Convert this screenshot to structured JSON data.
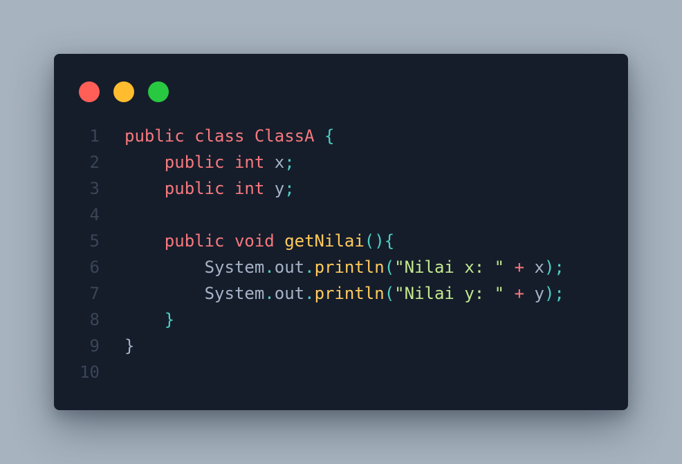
{
  "window": {
    "controls": [
      {
        "name": "close",
        "color": "#ff5f57"
      },
      {
        "name": "minimize",
        "color": "#febc2e"
      },
      {
        "name": "maximize",
        "color": "#28c840"
      }
    ]
  },
  "colors": {
    "keyword": "#f7797d",
    "function": "#ffcb5c",
    "string": "#c3e88d",
    "punctuation": "#4fd1c5",
    "identifier": "#a6b3c6",
    "line_number": "#3a4556",
    "background": "#151d2b"
  },
  "code": {
    "language": "java",
    "lines": [
      {
        "n": "1",
        "tokens": [
          {
            "t": "public",
            "c": "kw"
          },
          {
            "t": " ",
            "c": "id"
          },
          {
            "t": "class",
            "c": "kw"
          },
          {
            "t": " ",
            "c": "id"
          },
          {
            "t": "ClassA",
            "c": "kw"
          },
          {
            "t": " ",
            "c": "id"
          },
          {
            "t": "{",
            "c": "pn"
          }
        ]
      },
      {
        "n": "2",
        "tokens": [
          {
            "t": "    ",
            "c": "id"
          },
          {
            "t": "public",
            "c": "kw"
          },
          {
            "t": " ",
            "c": "id"
          },
          {
            "t": "int",
            "c": "kw"
          },
          {
            "t": " ",
            "c": "id"
          },
          {
            "t": "x",
            "c": "id"
          },
          {
            "t": ";",
            "c": "pn"
          }
        ]
      },
      {
        "n": "3",
        "tokens": [
          {
            "t": "    ",
            "c": "id"
          },
          {
            "t": "public",
            "c": "kw"
          },
          {
            "t": " ",
            "c": "id"
          },
          {
            "t": "int",
            "c": "kw"
          },
          {
            "t": " ",
            "c": "id"
          },
          {
            "t": "y",
            "c": "id"
          },
          {
            "t": ";",
            "c": "pn"
          }
        ]
      },
      {
        "n": "4",
        "tokens": []
      },
      {
        "n": "5",
        "tokens": [
          {
            "t": "    ",
            "c": "id"
          },
          {
            "t": "public",
            "c": "kw"
          },
          {
            "t": " ",
            "c": "id"
          },
          {
            "t": "void",
            "c": "kw"
          },
          {
            "t": " ",
            "c": "id"
          },
          {
            "t": "getNilai",
            "c": "fn"
          },
          {
            "t": "(){",
            "c": "pn"
          }
        ]
      },
      {
        "n": "6",
        "tokens": [
          {
            "t": "        ",
            "c": "id"
          },
          {
            "t": "System",
            "c": "id"
          },
          {
            "t": ".",
            "c": "pn"
          },
          {
            "t": "out",
            "c": "id"
          },
          {
            "t": ".",
            "c": "pn"
          },
          {
            "t": "println",
            "c": "fn"
          },
          {
            "t": "(",
            "c": "pn"
          },
          {
            "t": "\"Nilai x: \"",
            "c": "str"
          },
          {
            "t": " ",
            "c": "id"
          },
          {
            "t": "+",
            "c": "op"
          },
          {
            "t": " ",
            "c": "id"
          },
          {
            "t": "x",
            "c": "id"
          },
          {
            "t": ");",
            "c": "pn"
          }
        ]
      },
      {
        "n": "7",
        "tokens": [
          {
            "t": "        ",
            "c": "id"
          },
          {
            "t": "System",
            "c": "id"
          },
          {
            "t": ".",
            "c": "pn"
          },
          {
            "t": "out",
            "c": "id"
          },
          {
            "t": ".",
            "c": "pn"
          },
          {
            "t": "println",
            "c": "fn"
          },
          {
            "t": "(",
            "c": "pn"
          },
          {
            "t": "\"Nilai y: \"",
            "c": "str"
          },
          {
            "t": " ",
            "c": "id"
          },
          {
            "t": "+",
            "c": "op"
          },
          {
            "t": " ",
            "c": "id"
          },
          {
            "t": "y",
            "c": "id"
          },
          {
            "t": ");",
            "c": "pn"
          }
        ]
      },
      {
        "n": "8",
        "tokens": [
          {
            "t": "    ",
            "c": "id"
          },
          {
            "t": "}",
            "c": "pn"
          }
        ]
      },
      {
        "n": "9",
        "tokens": [
          {
            "t": "}",
            "c": "id"
          }
        ]
      },
      {
        "n": "10",
        "tokens": []
      }
    ]
  }
}
